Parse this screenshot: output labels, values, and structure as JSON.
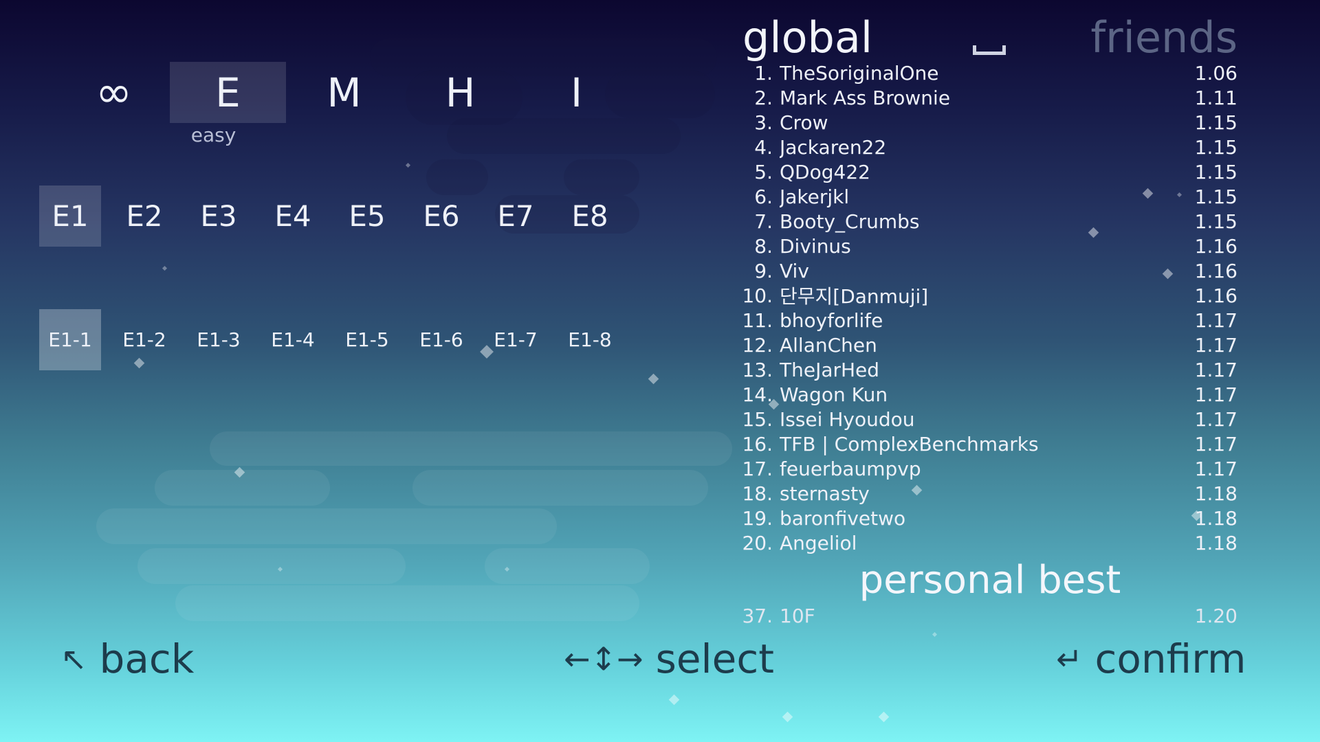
{
  "difficulty": {
    "tabs": [
      {
        "label": "∞"
      },
      {
        "label": "E"
      },
      {
        "label": "M"
      },
      {
        "label": "H"
      },
      {
        "label": "I"
      }
    ],
    "selected_index": 1,
    "selected_name": "easy"
  },
  "episodes": {
    "tabs": [
      "E1",
      "E2",
      "E3",
      "E4",
      "E5",
      "E6",
      "E7",
      "E8"
    ],
    "selected_index": 0
  },
  "levels": {
    "tabs": [
      "E1-1",
      "E1-2",
      "E1-3",
      "E1-4",
      "E1-5",
      "E1-6",
      "E1-7",
      "E1-8"
    ],
    "selected_index": 0
  },
  "leaderboard": {
    "tab_global": "global",
    "tab_friends": "friends",
    "active_tab": "global",
    "rows": [
      {
        "rank": "1.",
        "name": "TheSoriginalOne",
        "time": "1.06"
      },
      {
        "rank": "2.",
        "name": "Mark Ass Brownie",
        "time": "1.11"
      },
      {
        "rank": "3.",
        "name": "Crow",
        "time": "1.15"
      },
      {
        "rank": "4.",
        "name": "Jackaren22",
        "time": "1.15"
      },
      {
        "rank": "5.",
        "name": "QDog422",
        "time": "1.15"
      },
      {
        "rank": "6.",
        "name": "Jakerjkl",
        "time": "1.15"
      },
      {
        "rank": "7.",
        "name": "Booty_Crumbs",
        "time": "1.15"
      },
      {
        "rank": "8.",
        "name": "Divinus",
        "time": "1.16"
      },
      {
        "rank": "9.",
        "name": "Viv",
        "time": "1.16"
      },
      {
        "rank": "10.",
        "name": "단무지[Danmuji]",
        "time": "1.16"
      },
      {
        "rank": "11.",
        "name": "bhoyforlife",
        "time": "1.17"
      },
      {
        "rank": "12.",
        "name": "AllanChen",
        "time": "1.17"
      },
      {
        "rank": "13.",
        "name": "TheJarHed",
        "time": "1.17"
      },
      {
        "rank": "14.",
        "name": "Wagon Kun",
        "time": "1.17"
      },
      {
        "rank": "15.",
        "name": "Issei Hyoudou",
        "time": "1.17"
      },
      {
        "rank": "16.",
        "name": "TFB | ComplexBenchmarks",
        "time": "1.17"
      },
      {
        "rank": "17.",
        "name": "feuerbaumpvp",
        "time": "1.17"
      },
      {
        "rank": "18.",
        "name": "sternasty",
        "time": "1.18"
      },
      {
        "rank": "19.",
        "name": "baronfivetwo",
        "time": "1.18"
      },
      {
        "rank": "20.",
        "name": "Angeliol",
        "time": "1.18"
      }
    ]
  },
  "personal_best": {
    "title": "personal best",
    "rank": "37.",
    "name": "10F",
    "time": "1.20"
  },
  "hints": {
    "back": {
      "icon": "↖",
      "label": "back"
    },
    "select": {
      "icon": "←↕→",
      "label": "select"
    },
    "confirm": {
      "icon": "↵",
      "label": "confirm"
    }
  },
  "colors": {
    "bg_top": "#0c0730",
    "bg_bottom": "#7ef3f4",
    "hint_text": "#1d3c4c",
    "friends_inactive": "#5c6585"
  }
}
